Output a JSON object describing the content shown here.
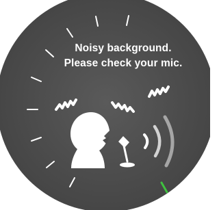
{
  "dialog": {
    "message_line1": "Noisy background.",
    "message_line2": "Please check your mic."
  },
  "icons": {
    "person": "person-speaking-icon",
    "microphone": "microphone-icon",
    "noise_left": "noise-squiggle-icon",
    "noise_center": "noise-squiggle-icon",
    "noise_right": "noise-squiggle-icon",
    "sound_waves": "sound-waves-icon"
  },
  "colors": {
    "dial_background": "#4d4d4d",
    "foreground": "#ffffff",
    "active_tick": "#3fc23f"
  }
}
